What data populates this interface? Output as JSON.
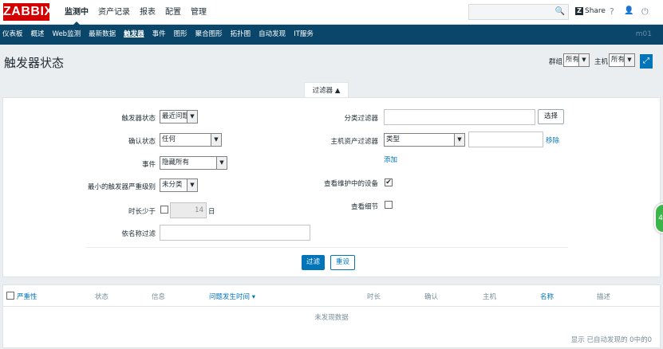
{
  "brand": {
    "logo": "ZABBIX",
    "color": "#d40000"
  },
  "top_menu": [
    {
      "label": "监测中",
      "active": true
    },
    {
      "label": "资产记录"
    },
    {
      "label": "报表"
    },
    {
      "label": "配置"
    },
    {
      "label": "管理"
    }
  ],
  "header": {
    "share_z": "Z",
    "share_label": "Share",
    "help_glyph": "?",
    "user_glyph": "👤",
    "logout_glyph": "⏻",
    "search_icon": "🔍"
  },
  "sub_menu": [
    {
      "label": "仪表板"
    },
    {
      "label": "概述"
    },
    {
      "label": "Web监测"
    },
    {
      "label": "最新数据"
    },
    {
      "label": "触发器",
      "active": true
    },
    {
      "label": "事件"
    },
    {
      "label": "图形"
    },
    {
      "label": "聚合图形"
    },
    {
      "label": "拓扑图"
    },
    {
      "label": "自动发现"
    },
    {
      "label": "IT服务"
    }
  ],
  "server_name": "m01",
  "page": {
    "title": "触发器状态",
    "group_label": "群组",
    "group_value": "所有",
    "host_label": "主机",
    "host_value": "所有",
    "fullscreen_glyph": "⤢"
  },
  "filter": {
    "tab_label": "过滤器 ▲",
    "trigger_status_label": "触发器状态",
    "trigger_status_value": "最近问题",
    "ack_status_label": "确认状态",
    "ack_status_value": "任何",
    "events_label": "事件",
    "events_value": "隐藏所有",
    "min_severity_label": "最小的触发器严重级别",
    "min_severity_value": "未分类",
    "age_label": "时长少于",
    "age_value": "14",
    "age_unit": "日",
    "name_label": "依名称过滤",
    "app_filter_label": "分类过滤器",
    "select_button": "选择",
    "inventory_label": "主机资产过滤器",
    "inventory_field_value": "类型",
    "remove_link": "移除",
    "add_link": "添加",
    "maintenance_label": "查看维护中的设备",
    "maintenance_checked": "✔",
    "details_label": "查看细节",
    "apply_button": "过滤",
    "reset_button": "重设"
  },
  "table": {
    "columns": [
      "严重性",
      "状态",
      "信息",
      "问题发生时间 ▾",
      "时长",
      "确认",
      "主机",
      "名称",
      "描述"
    ],
    "no_data": "未发现数据",
    "footer": "显示 已自动发现的 0中的0"
  },
  "float_widget": "45"
}
